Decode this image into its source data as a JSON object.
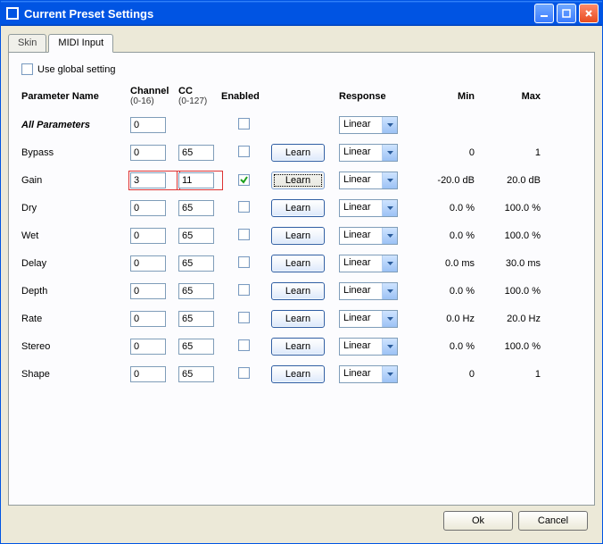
{
  "window": {
    "title": "Current Preset Settings"
  },
  "tabs": {
    "skin": "Skin",
    "midi": "MIDI Input"
  },
  "global": {
    "label": "Use global setting",
    "checked": false
  },
  "headers": {
    "param": "Parameter Name",
    "channel": "Channel",
    "channel_sub": "(0-16)",
    "cc": "CC",
    "cc_sub": "(0-127)",
    "enabled": "Enabled",
    "response": "Response",
    "min": "Min",
    "max": "Max"
  },
  "learn_label": "Learn",
  "response_value": "Linear",
  "all_params": {
    "label": "All Parameters",
    "channel": "0"
  },
  "rows": [
    {
      "name": "Bypass",
      "channel": "0",
      "cc": "65",
      "enabled": false,
      "min": "0",
      "max": "1"
    },
    {
      "name": "Gain",
      "channel": "3",
      "cc": "11",
      "enabled": true,
      "min": "-20.0 dB",
      "max": "20.0 dB",
      "highlight": true,
      "focused": true
    },
    {
      "name": "Dry",
      "channel": "0",
      "cc": "65",
      "enabled": false,
      "min": "0.0 %",
      "max": "100.0 %"
    },
    {
      "name": "Wet",
      "channel": "0",
      "cc": "65",
      "enabled": false,
      "min": "0.0 %",
      "max": "100.0 %"
    },
    {
      "name": "Delay",
      "channel": "0",
      "cc": "65",
      "enabled": false,
      "min": "0.0 ms",
      "max": "30.0 ms"
    },
    {
      "name": "Depth",
      "channel": "0",
      "cc": "65",
      "enabled": false,
      "min": "0.0 %",
      "max": "100.0 %"
    },
    {
      "name": "Rate",
      "channel": "0",
      "cc": "65",
      "enabled": false,
      "min": "0.0 Hz",
      "max": "20.0 Hz"
    },
    {
      "name": "Stereo",
      "channel": "0",
      "cc": "65",
      "enabled": false,
      "min": "0.0 %",
      "max": "100.0 %"
    },
    {
      "name": "Shape",
      "channel": "0",
      "cc": "65",
      "enabled": false,
      "min": "0",
      "max": "1"
    }
  ],
  "buttons": {
    "ok": "Ok",
    "cancel": "Cancel"
  }
}
